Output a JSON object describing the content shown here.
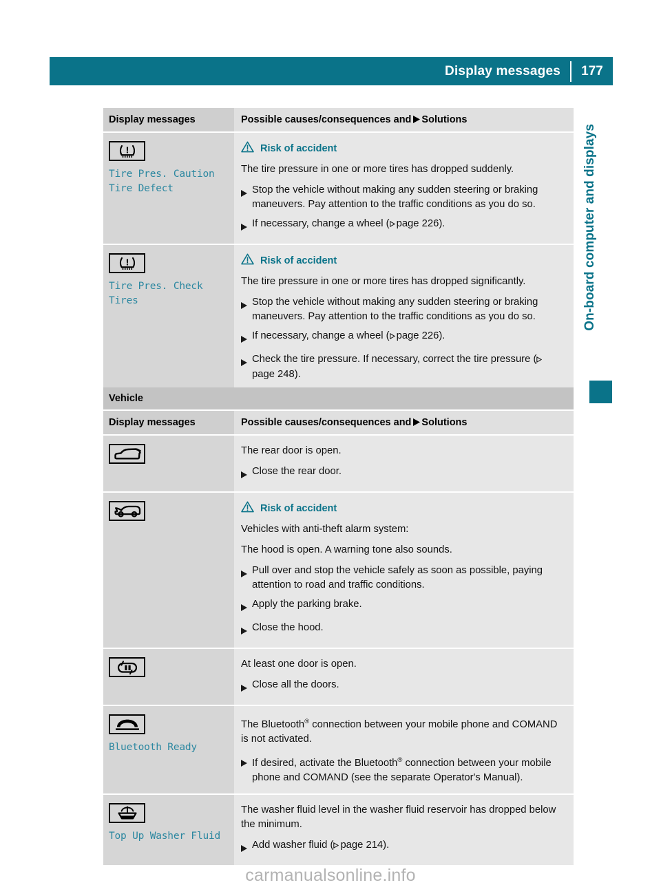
{
  "header": {
    "title": "Display messages",
    "page_number": "177"
  },
  "sidebar": {
    "chapter_label": "On-board computer and displays"
  },
  "watermark": "carmanualsonline.info",
  "colors": {
    "teal": "#0a7389",
    "message_teal": "#2b87a0",
    "left_cell_gray": "#d6d6d6",
    "right_cell_gray": "#e7e7e7",
    "section_gray": "#c3c3c3"
  },
  "table_headers": {
    "left": "Display messages",
    "right_before": "Possible causes/consequences and",
    "right_after": "Solutions"
  },
  "section_vehicle_title": "Vehicle",
  "tire_rows": [
    {
      "icon": "tire-pressure-warning-icon",
      "messages": [
        "Tire Pres. Caution",
        "Tire Defect"
      ],
      "warning": "Risk of accident",
      "intro": "The tire pressure in one or more tires has dropped suddenly.",
      "solutions": [
        {
          "text": "Stop the vehicle without making any sudden steering or braking maneuvers. Pay attention to the traffic conditions as you do so."
        },
        {
          "text": "If necessary, change a wheel (",
          "xref": "page 226",
          "tail": ")."
        }
      ]
    },
    {
      "icon": "tire-pressure-warning-icon",
      "messages": [
        "Tire Pres. Check",
        "Tires"
      ],
      "warning": "Risk of accident",
      "intro": "The tire pressure in one or more tires has dropped significantly.",
      "solutions": [
        {
          "text": "Stop the vehicle without making any sudden steering or braking maneuvers. Pay attention to the traffic conditions as you do so."
        },
        {
          "text": "If necessary, change a wheel (",
          "xref": "page 226",
          "tail": ")."
        },
        {
          "text": "Check the tire pressure. If necessary, correct the tire pressure (",
          "xref": "page 248",
          "tail": ")."
        }
      ]
    }
  ],
  "vehicle_rows": [
    {
      "icon": "rear-door-open-icon",
      "messages": [],
      "warning": null,
      "intro": "The rear door is open.",
      "intro2": null,
      "solutions": [
        {
          "text": "Close the rear door."
        }
      ]
    },
    {
      "icon": "hood-open-icon",
      "messages": [],
      "warning": "Risk of accident",
      "intro": "Vehicles with anti-theft alarm system:",
      "intro2": "The hood is open. A warning tone also sounds.",
      "solutions": [
        {
          "text": "Pull over and stop the vehicle safely as soon as possible, paying attention to road and traffic conditions."
        },
        {
          "text": "Apply the parking brake."
        },
        {
          "text": "Close the hood."
        }
      ]
    },
    {
      "icon": "doors-open-icon",
      "messages": [],
      "warning": null,
      "intro": "At least one door is open.",
      "intro2": null,
      "solutions": [
        {
          "text": "Close all the doors."
        }
      ]
    },
    {
      "icon": "telephone-handset-icon",
      "messages": [
        "Bluetooth Ready"
      ],
      "warning": null,
      "intro_pre": "The Bluetooth",
      "intro_post": " connection between your mobile phone and COMAND is not activated.",
      "intro2": null,
      "solutions": [
        {
          "pre": "If desired, activate the Bluetooth",
          "post": " connection between your mobile phone and COMAND (see the separate Operator's Manual)."
        }
      ]
    },
    {
      "icon": "washer-fluid-icon",
      "messages": [
        "Top Up Washer Fluid"
      ],
      "warning": null,
      "intro": "The washer fluid level in the washer fluid reservoir has dropped below the minimum.",
      "intro2": null,
      "solutions": [
        {
          "text": "Add washer fluid (",
          "xref": "page 214",
          "tail": ")."
        }
      ]
    }
  ]
}
